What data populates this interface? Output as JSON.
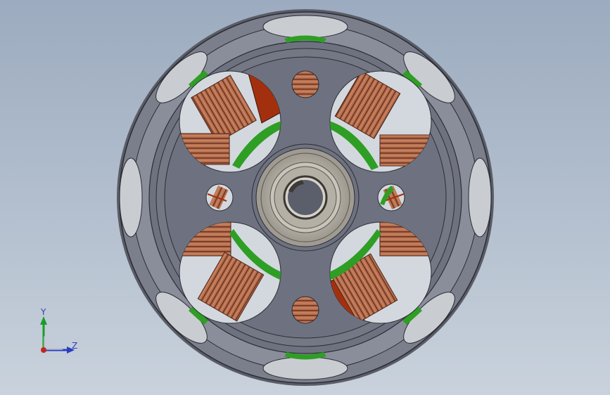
{
  "viewport": {
    "background_top": "#9cabbf",
    "background_bottom": "#c9d2dc"
  },
  "model": {
    "colors": {
      "housing": "#7b7f8c",
      "housing_dark": "#4b4e59",
      "stator_plate": "#6e7280",
      "copper_winding": "#b0684e",
      "red_core": "#a2300f",
      "green_insulation": "#2e9e24",
      "bearing": "#bdb8ae",
      "hole_background": "#d3d8de"
    }
  },
  "triad": {
    "y_label": "Y",
    "z_label": "Z",
    "colors": {
      "y": "#1a9c2a",
      "z": "#2a3ec0",
      "x": "#c0281e"
    }
  }
}
